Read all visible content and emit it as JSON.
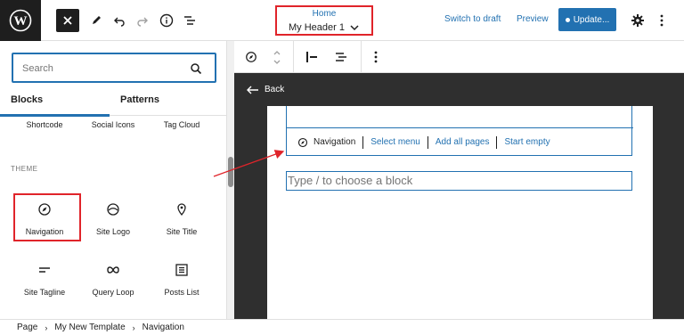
{
  "header": {
    "document_subtitle": "Home",
    "document_title": "My Header 1",
    "switch_to_draft": "Switch to draft",
    "preview": "Preview",
    "update": "Update..."
  },
  "sidebar": {
    "search_placeholder": "Search",
    "tabs": [
      "Blocks",
      "Patterns"
    ],
    "top_items": [
      "Shortcode",
      "Social Icons",
      "Tag Cloud"
    ],
    "section_label": "THEME",
    "theme_items": [
      "Navigation",
      "Site Logo",
      "Site Title",
      "Site Tagline",
      "Query Loop",
      "Posts List"
    ]
  },
  "canvas": {
    "back_label": "Back",
    "nav_toolbar": [
      "Navigation",
      "Select menu",
      "Add all pages",
      "Start empty"
    ],
    "placeholder": "Type / to choose a block"
  },
  "breadcrumb": [
    "Page",
    "My New Template",
    "Navigation"
  ],
  "colors": {
    "accent": "#2271b1",
    "annotation": "#e0242a",
    "canvas_bg": "#2f2f2f"
  }
}
